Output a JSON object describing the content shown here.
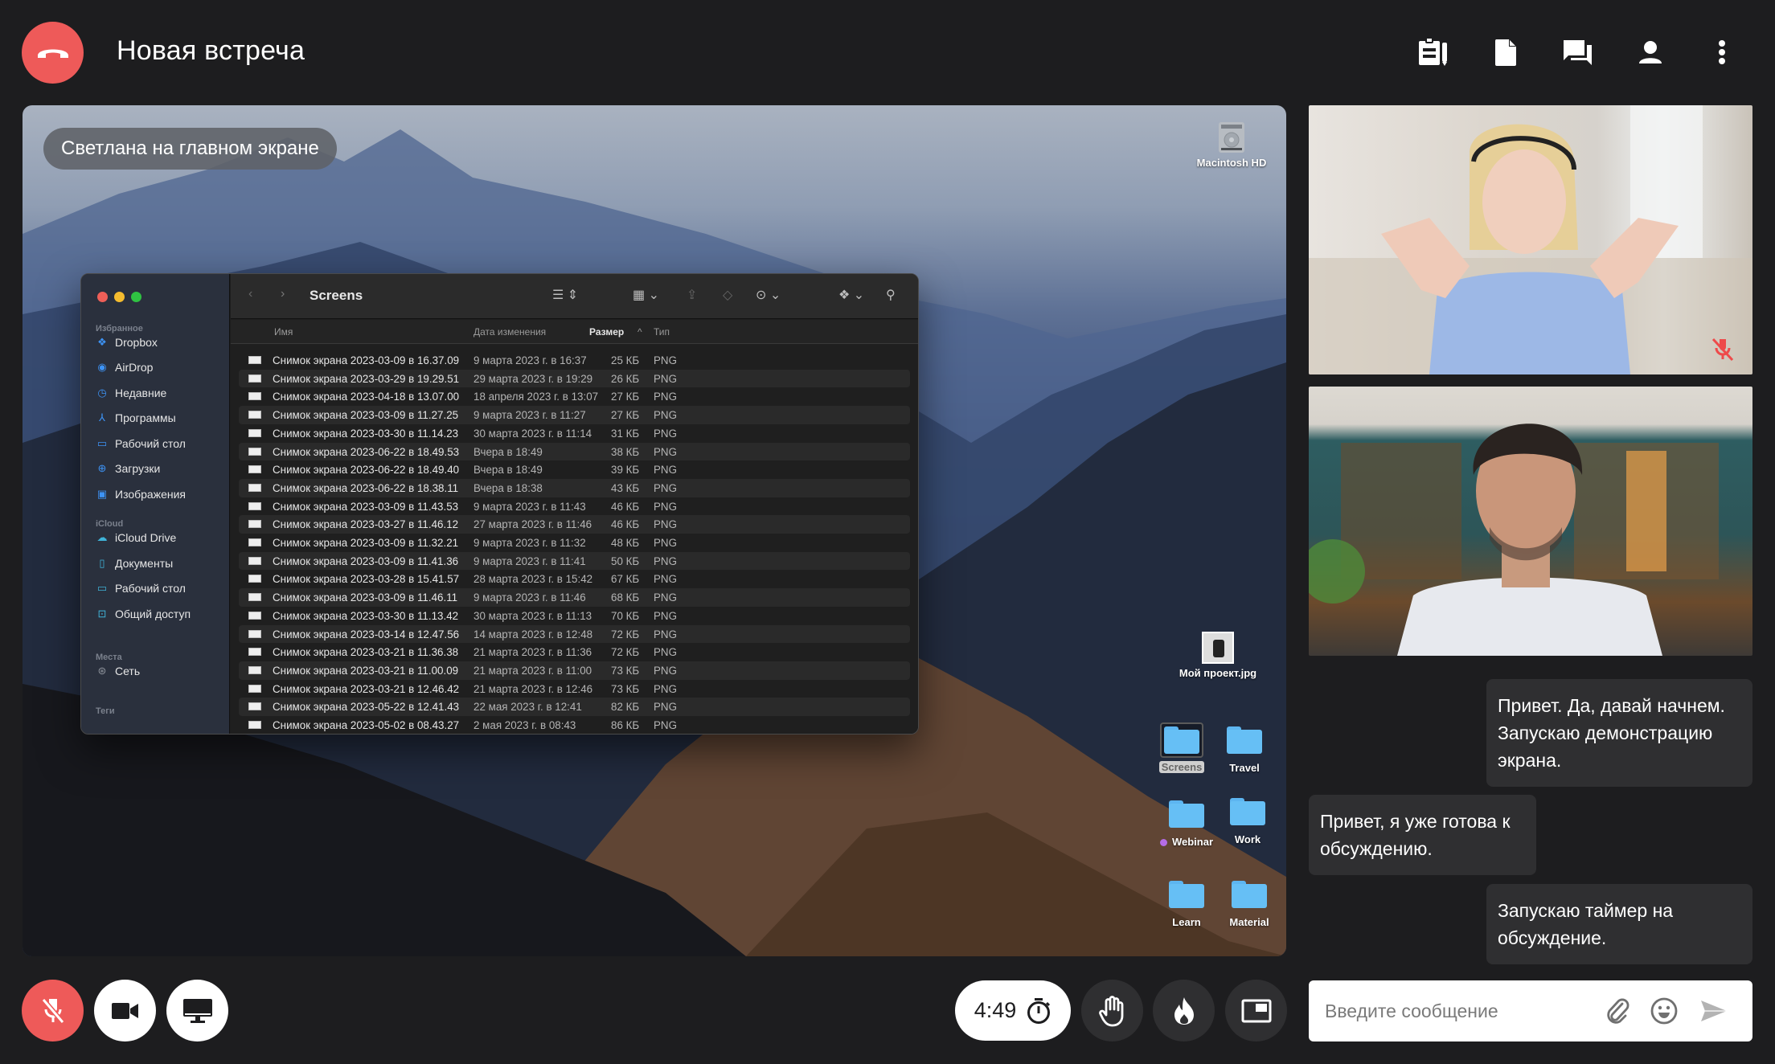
{
  "header": {
    "title": "Новая встреча",
    "icons": [
      "notes-icon",
      "document-icon",
      "chat-icon",
      "participants-icon",
      "more-options-icon"
    ]
  },
  "colors": {
    "background": "#1d1d1f",
    "accent_red": "#ee5a59",
    "bubble": "#2f2f31",
    "control_dark": "#2f2f31",
    "folder_blue": "#66bff5",
    "tag_purple": "#b56ce6"
  },
  "screen_share": {
    "label": "Светлана на главном экране",
    "desktop": {
      "drive_label": "Macintosh HD",
      "file_label": "Мой проект.jpg",
      "folders": [
        {
          "label": "Screens",
          "selected": true
        },
        {
          "label": "Travel"
        },
        {
          "label": "Webinar",
          "tag": "purple"
        },
        {
          "label": "Work"
        },
        {
          "label": "Learn"
        },
        {
          "label": "Material"
        }
      ]
    },
    "finder": {
      "title": "Screens",
      "sidebar": {
        "favorites_heading": "Избранное",
        "favorites": [
          "Dropbox",
          "AirDrop",
          "Недавние",
          "Программы",
          "Рабочий стол",
          "Загрузки",
          "Изображения"
        ],
        "icloud_heading": "iCloud",
        "icloud": [
          "iCloud Drive",
          "Документы",
          "Рабочий стол",
          "Общий доступ"
        ],
        "places_heading": "Места",
        "places": [
          "Сеть"
        ],
        "tags_heading": "Теги"
      },
      "columns": {
        "name": "Имя",
        "date": "Дата изменения",
        "size": "Размер",
        "type": "Тип"
      },
      "sort_indicator": "^",
      "rows": [
        {
          "name": "Снимок экрана 2023-03-09 в 16.37.09",
          "date": "9 марта 2023 г. в 16:37",
          "size": "25 КБ",
          "type": "PNG"
        },
        {
          "name": "Снимок экрана 2023-03-29 в 19.29.51",
          "date": "29 марта 2023 г. в 19:29",
          "size": "26 КБ",
          "type": "PNG"
        },
        {
          "name": "Снимок экрана 2023-04-18 в 13.07.00",
          "date": "18 апреля 2023 г. в 13:07",
          "size": "27 КБ",
          "type": "PNG"
        },
        {
          "name": "Снимок экрана 2023-03-09 в 11.27.25",
          "date": "9 марта 2023 г. в 11:27",
          "size": "27 КБ",
          "type": "PNG"
        },
        {
          "name": "Снимок экрана 2023-03-30 в 11.14.23",
          "date": "30 марта 2023 г. в 11:14",
          "size": "31 КБ",
          "type": "PNG"
        },
        {
          "name": "Снимок экрана 2023-06-22 в 18.49.53",
          "date": "Вчера в 18:49",
          "size": "38 КБ",
          "type": "PNG"
        },
        {
          "name": "Снимок экрана 2023-06-22 в 18.49.40",
          "date": "Вчера в 18:49",
          "size": "39 КБ",
          "type": "PNG"
        },
        {
          "name": "Снимок экрана 2023-06-22 в 18.38.11",
          "date": "Вчера в 18:38",
          "size": "43 КБ",
          "type": "PNG"
        },
        {
          "name": "Снимок экрана 2023-03-09 в 11.43.53",
          "date": "9 марта 2023 г. в 11:43",
          "size": "46 КБ",
          "type": "PNG"
        },
        {
          "name": "Снимок экрана 2023-03-27 в 11.46.12",
          "date": "27 марта 2023 г. в 11:46",
          "size": "46 КБ",
          "type": "PNG"
        },
        {
          "name": "Снимок экрана 2023-03-09 в 11.32.21",
          "date": "9 марта 2023 г. в 11:32",
          "size": "48 КБ",
          "type": "PNG"
        },
        {
          "name": "Снимок экрана 2023-03-09 в 11.41.36",
          "date": "9 марта 2023 г. в 11:41",
          "size": "50 КБ",
          "type": "PNG"
        },
        {
          "name": "Снимок экрана 2023-03-28 в 15.41.57",
          "date": "28 марта 2023 г. в 15:42",
          "size": "67 КБ",
          "type": "PNG"
        },
        {
          "name": "Снимок экрана 2023-03-09 в 11.46.11",
          "date": "9 марта 2023 г. в 11:46",
          "size": "68 КБ",
          "type": "PNG"
        },
        {
          "name": "Снимок экрана 2023-03-30 в 11.13.42",
          "date": "30 марта 2023 г. в 11:13",
          "size": "70 КБ",
          "type": "PNG"
        },
        {
          "name": "Снимок экрана 2023-03-14 в 12.47.56",
          "date": "14 марта 2023 г. в 12:48",
          "size": "72 КБ",
          "type": "PNG"
        },
        {
          "name": "Снимок экрана 2023-03-21 в 11.36.38",
          "date": "21 марта 2023 г. в 11:36",
          "size": "72 КБ",
          "type": "PNG"
        },
        {
          "name": "Снимок экрана 2023-03-21 в 11.00.09",
          "date": "21 марта 2023 г. в 11:00",
          "size": "73 КБ",
          "type": "PNG"
        },
        {
          "name": "Снимок экрана 2023-03-21 в 12.46.42",
          "date": "21 марта 2023 г. в 12:46",
          "size": "73 КБ",
          "type": "PNG"
        },
        {
          "name": "Снимок экрана 2023-05-22 в 12.41.43",
          "date": "22 мая 2023 г. в 12:41",
          "size": "82 КБ",
          "type": "PNG"
        },
        {
          "name": "Снимок экрана 2023-05-02 в 08.43.27",
          "date": "2 мая 2023 г. в 08:43",
          "size": "86 КБ",
          "type": "PNG"
        }
      ]
    }
  },
  "participants": [
    {
      "tile": 1,
      "muted": true
    },
    {
      "tile": 2,
      "muted": false
    }
  ],
  "chat": {
    "messages": [
      {
        "side": "right",
        "text": "Привет. Да, давай начнем. Запускаю демонстрацию экрана."
      },
      {
        "side": "left",
        "text": "Привет, я уже готова к обсуждению."
      },
      {
        "side": "right",
        "text": "Запускаю таймер на обсуждение."
      }
    ],
    "input_placeholder": "Введите сообщение"
  },
  "controls": {
    "timer": "4:49",
    "mic_muted": true
  }
}
